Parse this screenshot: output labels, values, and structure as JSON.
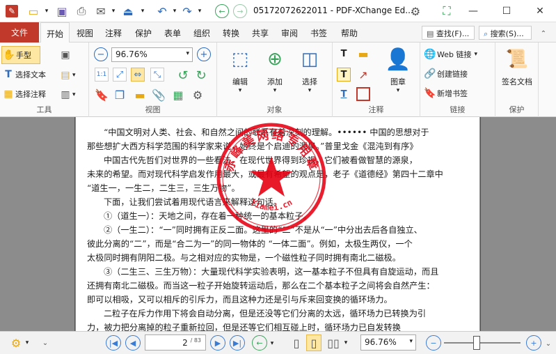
{
  "window": {
    "title": "05172072622011 - PDF-XChange Ed...",
    "minimize_icon": "—",
    "maximize_icon": "☐",
    "close_icon": "✕"
  },
  "menu": {
    "file": "文件",
    "items": [
      "开始",
      "视图",
      "注释",
      "保护",
      "表单",
      "组织",
      "转换",
      "共享",
      "审阅",
      "书签",
      "帮助"
    ],
    "find": "查找(F)...",
    "search": "搜索(S)..."
  },
  "ribbon": {
    "tools": {
      "hand": "手型",
      "select_text": "选择文本",
      "select_annot": "选择注释",
      "label": "工具"
    },
    "view": {
      "zoom": "96.76%",
      "label": "视图"
    },
    "objects": {
      "edit": "编辑",
      "add": "添加",
      "select": "选择",
      "label": "对象"
    },
    "comments": {
      "stamp": "图章",
      "label": "注释"
    },
    "links": {
      "web": "Web 链接",
      "create": "创建链接",
      "bookmark": "新增书签",
      "label": "链接"
    },
    "protect": {
      "sign": "签名文档",
      "label": "保护"
    }
  },
  "document": {
    "paragraphs": [
      "“中国文明对人类、社会、和自然之间的联系有着深刻的理解。•••••• 中国的思想对于",
      "那些想扩大西方科学范围的科学家来说，始终是个启迪的源泉。”普里戈金《混沌到有序》",
      "中国古代先哲们对世界的一些看法，在现代世界得到珍视，它们被看做智慧的源泉，",
      "未来的希望。而对现代科学启发作用最大，或最有希望的观点是，老子《道德经》第四十二章中",
      "“道生一，一生二，二生三，三生万物”。",
      "下面，让我们尝试着用现代语言来解释这句话。",
      "①（道生一）：天地之间，存在着一种统一的基本粒子。",
      "②（一生二）：“一”同时拥有正反二面。这里的“二”不是从“一”中分出去后各自独立、",
      "彼此分离的“二”，而是“合二为一”的同一物体的 “一体二面”。例如，太极生两仪，一个",
      "太极同时拥有阴阳二极。与之相对应的实物是，一个磁性粒子同时拥有南北二磁极。",
      "③（二生三、三生万物）：大量现代科学实验表明，这一基本粒子不但具有自旋运动，而且",
      "还拥有南北二磁极。而当这一粒子开始旋转运动后，那么在二个基本粒子之间将会自然产生：",
      "即可以相吸，又可以相斥的引斥力，而且这种力还是引与斥来回变换的循环场力。",
      "二粒子在斥力作用下将会自动分离，但是还没等它们分离的太远，循环场力已转换为引",
      "力，被力把分离掉的粒子重新拉回，但是还等它们相互碰上时，循环场力已自发转换"
    ],
    "stamp": {
      "text": "赤峰美网络专用章",
      "subtext": "Yiamei.cn",
      "color": "#e60012"
    }
  },
  "statusbar": {
    "page_current": "2",
    "page_total": "/ 83",
    "zoom": "96.76%"
  }
}
